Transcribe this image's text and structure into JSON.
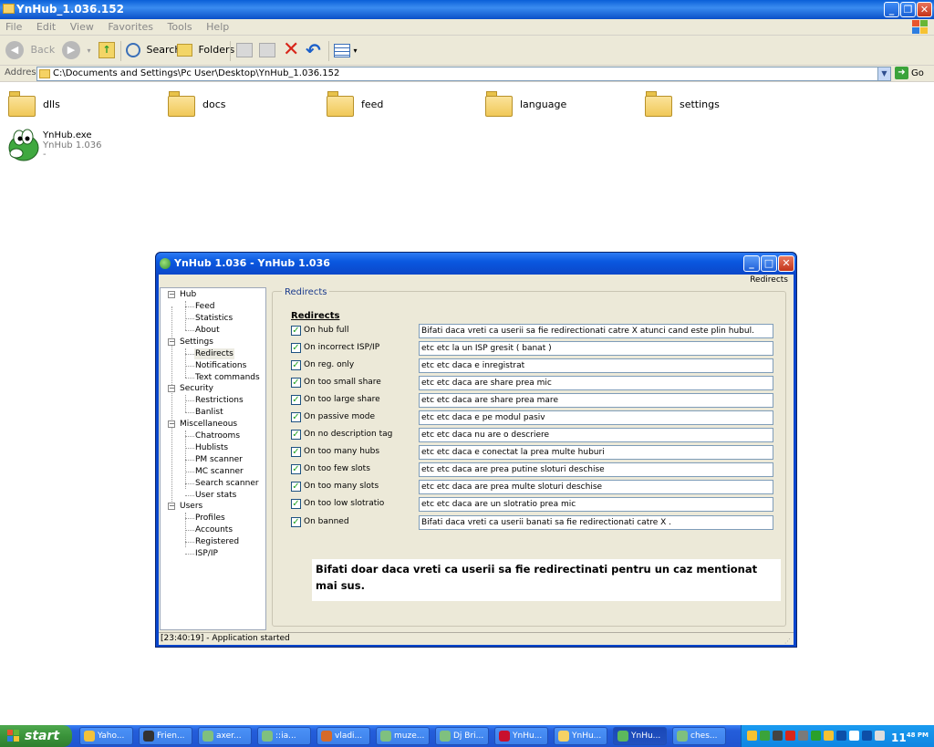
{
  "explorer": {
    "title": "YnHub_1.036.152",
    "menu": [
      "File",
      "Edit",
      "View",
      "Favorites",
      "Tools",
      "Help"
    ],
    "toolbar": {
      "back": "Back",
      "search": "Search",
      "folders": "Folders"
    },
    "address_label": "Address",
    "address": "C:\\Documents and Settings\\Pc User\\Desktop\\YnHub_1.036.152",
    "go": "Go",
    "folders": [
      "dlls",
      "docs",
      "feed",
      "language",
      "settings"
    ],
    "file": {
      "name": "YnHub.exe",
      "desc": "YnHub 1.036",
      "extra": "-"
    }
  },
  "ynhub": {
    "title": "YnHub 1.036 - YnHub 1.036",
    "crumb": "Redirects",
    "tree": {
      "hub": "Hub",
      "feed": "Feed",
      "statistics": "Statistics",
      "about": "About",
      "settings": "Settings",
      "redirects": "Redirects",
      "notifications": "Notifications",
      "text_commands": "Text commands",
      "security": "Security",
      "restrictions": "Restrictions",
      "banlist": "Banlist",
      "misc": "Miscellaneous",
      "chatrooms": "Chatrooms",
      "hublists": "Hublists",
      "pm_scanner": "PM scanner",
      "mc_scanner": "MC scanner",
      "search_scanner": "Search scanner",
      "user_stats": "User stats",
      "users": "Users",
      "profiles": "Profiles",
      "accounts": "Accounts",
      "registered": "Registered",
      "isp_ip": "ISP/IP"
    },
    "panel_title": "Redirects",
    "panel_heading": "Redirects",
    "options": [
      {
        "label": "On hub full",
        "checked": true,
        "value": "Bifati daca vreti ca  userii  sa fie redirectionati catre X atunci cand este plin hubul."
      },
      {
        "label": "On incorrect ISP/IP",
        "checked": true,
        "value": "etc etc la un ISP gresit ( banat )"
      },
      {
        "label": "On reg. only",
        "checked": true,
        "value": "etc etc daca e inregistrat"
      },
      {
        "label": "On too small share",
        "checked": true,
        "value": "etc etc   daca are share prea mic"
      },
      {
        "label": "On too large share",
        "checked": true,
        "value": "etc etc   daca are share prea mare"
      },
      {
        "label": "On passive mode",
        "checked": true,
        "value": "etc etc    daca e pe modul pasiv"
      },
      {
        "label": "On no description tag",
        "checked": true,
        "value": "etc etc      daca nu are o descriere"
      },
      {
        "label": "On too many hubs",
        "checked": true,
        "value": "etc etc    daca e conectat la prea multe huburi"
      },
      {
        "label": "On too few slots",
        "checked": true,
        "value": "etc etc      daca are prea putine sloturi deschise"
      },
      {
        "label": "On too many slots",
        "checked": true,
        "value": "etc etc       daca are prea multe sloturi deschise"
      },
      {
        "label": "On too low slotratio",
        "checked": true,
        "value": "etc etc       daca are un slotratio prea mic"
      },
      {
        "label": "On banned",
        "checked": true,
        "value": "Bifati daca vreti ca userii banati sa fie redirectionati catre X ."
      }
    ],
    "note": "Bifati doar daca vreti ca userii sa fie redirectinati  pentru un caz mentionat mai sus.",
    "status": "[23:40:19] - Application started"
  },
  "taskbar": {
    "start": "start",
    "tasks": [
      {
        "label": "Yaho...",
        "icon_color": "#f3c23a"
      },
      {
        "label": "Frien...",
        "icon_color": "#333333"
      },
      {
        "label": "axer...",
        "icon_color": "#7fc07f"
      },
      {
        "label": "::ia...",
        "icon_color": "#7fc07f"
      },
      {
        "label": "vladi...",
        "icon_color": "#d66a2a"
      },
      {
        "label": "muze...",
        "icon_color": "#7fc07f"
      },
      {
        "label": "Dj Bri...",
        "icon_color": "#7fc07f"
      },
      {
        "label": "YnHu...",
        "icon_color": "#c8102e"
      },
      {
        "label": "YnHu...",
        "icon_color": "#f5d264"
      },
      {
        "label": "YnHu...",
        "icon_color": "#5cb85c"
      },
      {
        "label": "ches...",
        "icon_color": "#7fc07f"
      }
    ],
    "time": "11",
    "time_suffix": "48 PM"
  }
}
